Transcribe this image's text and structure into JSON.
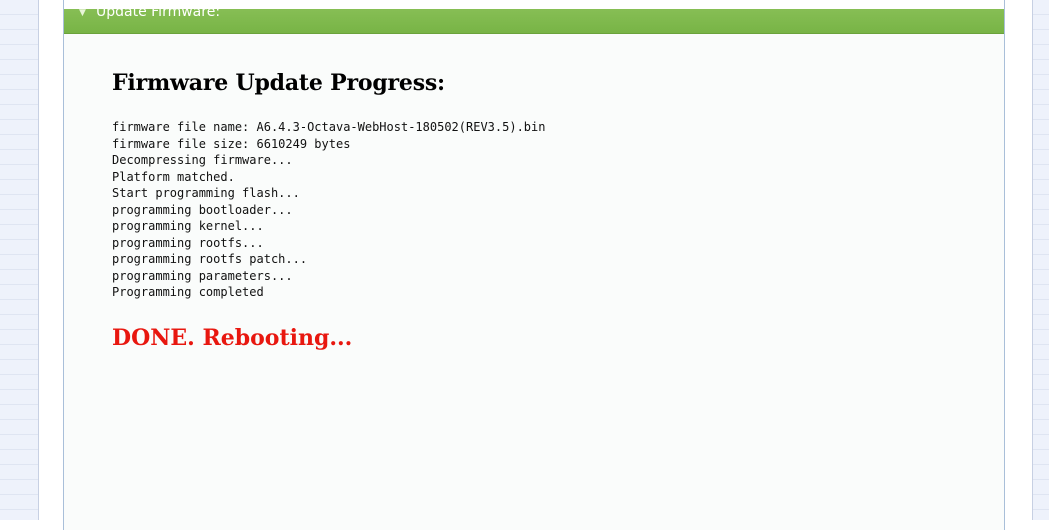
{
  "section": {
    "title": "Update Firmware:",
    "chevron_icon": "chevron-down-icon"
  },
  "progress": {
    "heading": "Firmware Update Progress:",
    "log_lines": [
      "firmware file name: A6.4.3-Octava-WebHost-180502(REV3.5).bin",
      "firmware file size: 6610249 bytes",
      "Decompressing firmware...",
      "Platform matched.",
      "Start programming flash...",
      "programming bootloader...",
      "programming kernel...",
      "programming rootfs...",
      "programming rootfs patch...",
      "programming parameters...",
      "Programming completed"
    ],
    "status": "DONE. Rebooting..."
  },
  "colors": {
    "header_green": "#7ab848",
    "status_red": "#e8170f"
  }
}
